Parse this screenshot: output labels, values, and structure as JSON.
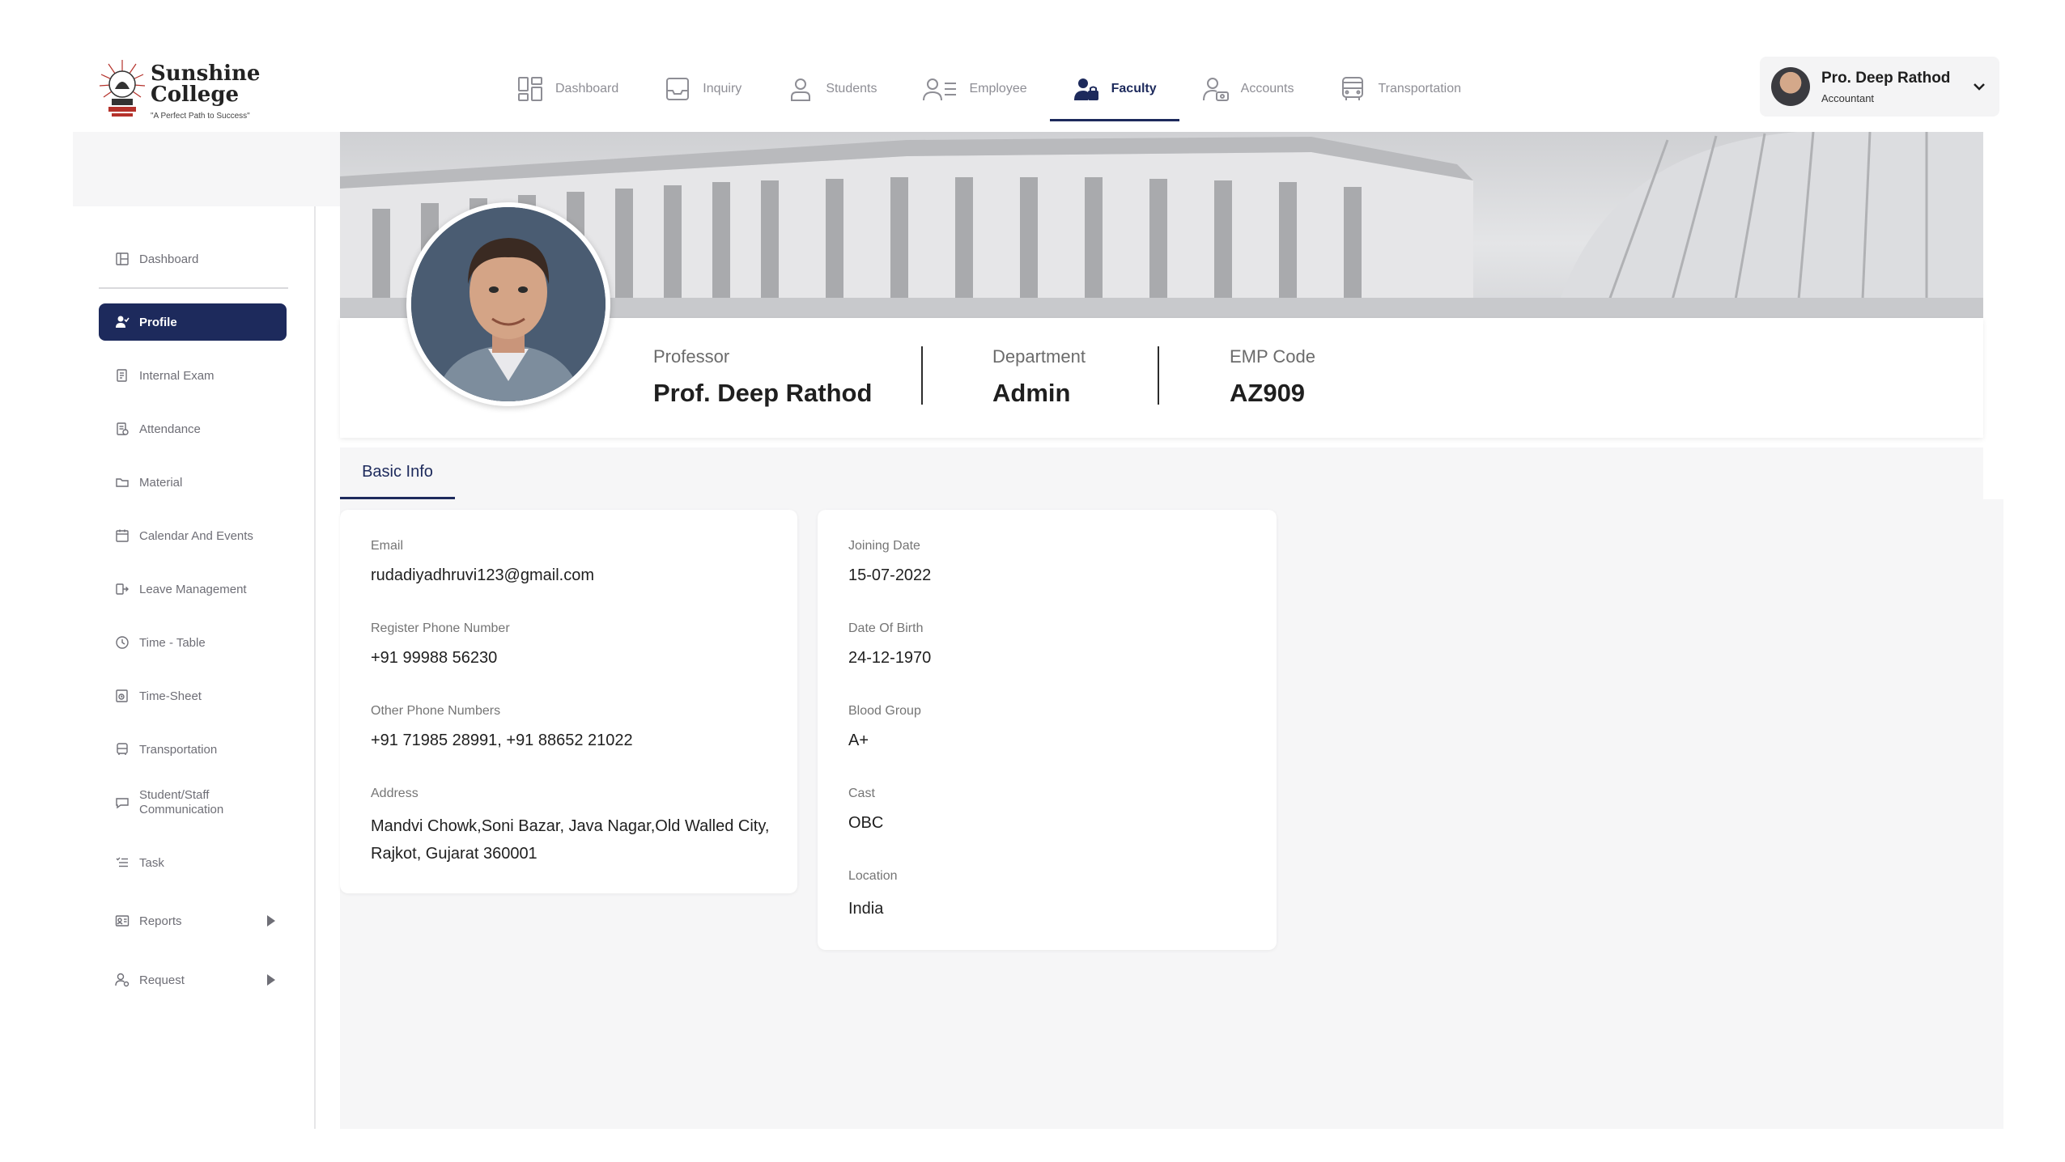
{
  "logo": {
    "title_line1": "Sunshine",
    "title_line2": "College",
    "tagline": "\"A Perfect Path to Success\""
  },
  "nav": [
    {
      "label": "Dashboard",
      "icon": "dashboard-icon"
    },
    {
      "label": "Inquiry",
      "icon": "inbox-icon"
    },
    {
      "label": "Students",
      "icon": "student-icon"
    },
    {
      "label": "Employee",
      "icon": "employee-icon"
    },
    {
      "label": "Faculty",
      "icon": "faculty-icon",
      "active": true
    },
    {
      "label": "Accounts",
      "icon": "accounts-icon"
    },
    {
      "label": "Transportation",
      "icon": "bus-icon"
    }
  ],
  "user": {
    "name": "Pro. Deep Rathod",
    "role": "Accountant"
  },
  "sidebar": {
    "items": [
      {
        "label": "Dashboard"
      },
      {
        "label": "Profile",
        "active": true
      },
      {
        "label": "Internal Exam"
      },
      {
        "label": "Attendance"
      },
      {
        "label": "Material"
      },
      {
        "label": "Calendar And Events"
      },
      {
        "label": "Leave Management"
      },
      {
        "label": "Time - Table"
      },
      {
        "label": "Time-Sheet"
      },
      {
        "label": "Transportation"
      },
      {
        "label": "Student/Staff",
        "label2": "Communication"
      },
      {
        "label": "Task"
      },
      {
        "label": "Reports",
        "has_submenu": true
      },
      {
        "label": "Request",
        "has_submenu": true
      }
    ]
  },
  "profile": {
    "designation_label": "Professor",
    "name": "Prof. Deep Rathod",
    "department_label": "Department",
    "department": "Admin",
    "emp_code_label": "EMP Code",
    "emp_code": "AZ909"
  },
  "tabs": {
    "basic_info": "Basic Info"
  },
  "basic_info": {
    "email_label": "Email",
    "email": "rudadiyadhruvi123@gmail.com",
    "phone_label": "Register Phone Number",
    "phone": "+91 99988 56230",
    "other_phone_label": "Other Phone Numbers",
    "other_phone": "+91 71985 28991, +91 88652 21022",
    "address_label": "Address",
    "address_line1": "Mandvi Chowk,Soni Bazar, Java Nagar,Old Walled City,",
    "address_line2": "Rajkot, Gujarat 360001",
    "joining_label": "Joining Date",
    "joining": "15-07-2022",
    "dob_label": "Date Of Birth",
    "dob": "24-12-1970",
    "blood_label": "Blood Group",
    "blood": "A+",
    "cast_label": "Cast",
    "cast": "OBC",
    "location_label": "Location",
    "location": "India"
  },
  "colors": {
    "accent": "#1d2a5c",
    "muted": "#8e8e95",
    "panel": "#f6f6f7"
  }
}
